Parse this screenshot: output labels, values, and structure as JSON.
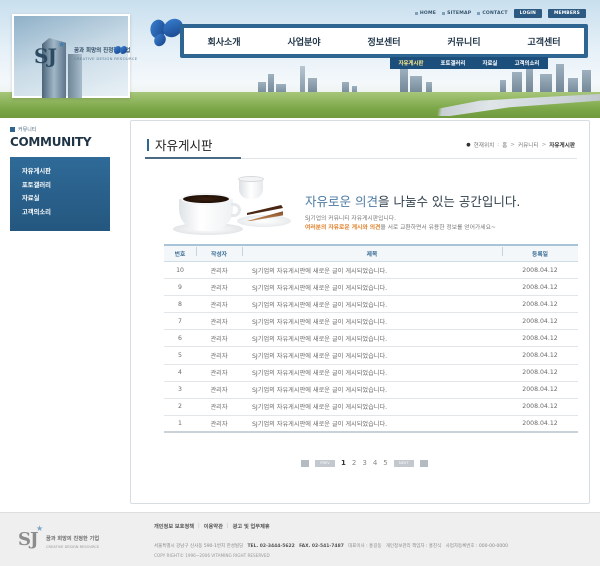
{
  "logo": {
    "tagline": "꿈과 희망의 진정한 기업",
    "subtitle": "CREATIVE DESIGN RESOURCE"
  },
  "util_nav": {
    "home": "HOME",
    "sitemap": "SITEMAP",
    "contact": "CONTACT",
    "login": "LOGIN",
    "members": "MEMBERS"
  },
  "main_nav": [
    "회사소개",
    "사업분야",
    "정보센터",
    "커뮤니티",
    "고객센터"
  ],
  "sub_nav": [
    "자유게시판",
    "포토갤러리",
    "자료실",
    "고객의소리"
  ],
  "sidebar": {
    "label_small": "커뮤니티",
    "title": "COMMUNITY",
    "items": [
      "자유게시판",
      "포토갤러리",
      "자료실",
      "고객의소리"
    ]
  },
  "page": {
    "title": "자유게시판",
    "breadcrumb": {
      "prefix": "현재위치",
      "items": [
        "홈",
        "커뮤니티"
      ],
      "current": "자유게시판"
    }
  },
  "intro": {
    "headline_highlight": "자유로운 의견",
    "headline_rest": "을 나눌수 있는 공간입니다.",
    "line1": "SJ기업의 커뮤니티 자유게시판입니다.",
    "line2_emph": "여러분의 자유로운 게시와 의견",
    "line2_rest": "을 서로 교환하면서 유용한 정보를 얻어가세요~"
  },
  "table": {
    "headers": {
      "num": "번호",
      "author": "작성자",
      "subject": "제목",
      "date": "등록일"
    },
    "rows": [
      {
        "num": "10",
        "author": "관리자",
        "subject": "SJ기업의 자유게시판에 새로운 글이 게시되었습니다.",
        "date": "2008.04.12"
      },
      {
        "num": "9",
        "author": "관리자",
        "subject": "SJ기업의 자유게시판에 새로운 글이 게시되었습니다.",
        "date": "2008.04.12"
      },
      {
        "num": "8",
        "author": "관리자",
        "subject": "SJ기업의 자유게시판에 새로운 글이 게시되었습니다.",
        "date": "2008.04.12"
      },
      {
        "num": "7",
        "author": "관리자",
        "subject": "SJ기업의 자유게시판에 새로운 글이 게시되었습니다.",
        "date": "2008.04.12"
      },
      {
        "num": "6",
        "author": "관리자",
        "subject": "SJ기업의 자유게시판에 새로운 글이 게시되었습니다.",
        "date": "2008.04.12"
      },
      {
        "num": "5",
        "author": "관리자",
        "subject": "SJ기업의 자유게시판에 새로운 글이 게시되었습니다.",
        "date": "2008.04.12"
      },
      {
        "num": "4",
        "author": "관리자",
        "subject": "SJ기업의 자유게시판에 새로운 글이 게시되었습니다.",
        "date": "2008.04.12"
      },
      {
        "num": "3",
        "author": "관리자",
        "subject": "SJ기업의 자유게시판에 새로운 글이 게시되었습니다.",
        "date": "2008.04.12"
      },
      {
        "num": "2",
        "author": "관리자",
        "subject": "SJ기업의 자유게시판에 새로운 글이 게시되었습니다.",
        "date": "2008.04.12"
      },
      {
        "num": "1",
        "author": "관리자",
        "subject": "SJ기업의 자유게시판에 새로운 글이 게시되었습니다.",
        "date": "2008.04.12"
      }
    ]
  },
  "pagination": {
    "prev_label": "PREV",
    "next_label": "NEXT",
    "pages": [
      "1",
      "2",
      "3",
      "4",
      "5"
    ],
    "current": "1"
  },
  "footer": {
    "tagline": "꿈과 희망의 진정한 기업",
    "subtitle": "CREATIVE DESIGN RESOURCE",
    "links": [
      "개인정보 보호정책",
      "이용약관",
      "광고 및 업무제휴"
    ],
    "address": "서울특별시 강남구 신사동 590-1번지 한성빌딩",
    "tel": "TEL. 02-3444-5622",
    "fax": "FAX. 02-541-7487",
    "ceo": "대표이사 : 홍길동",
    "privacy": "개인정보관리 책임자 : 홍진식",
    "biz": "사업자등록번호 : 000-00-0000",
    "copyright": "COPY RIGHT© 1996~2006 VITAMING RIGHT RESERVED"
  },
  "colors": {
    "brand_blue": "#2f6591",
    "accent_orange": "#e0812b",
    "headline_blue": "#4d7ba4"
  }
}
